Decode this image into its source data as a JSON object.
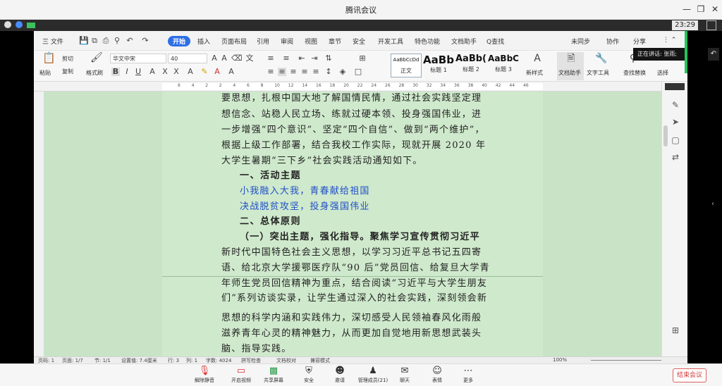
{
  "window": {
    "title": "腾讯会议",
    "time": "23:29"
  },
  "menu": {
    "file": "三 文件",
    "items": [
      "开始",
      "插入",
      "页面布局",
      "引用",
      "审阅",
      "视图",
      "章节",
      "安全",
      "开发工具",
      "特色功能",
      "文档助手",
      "Q查找"
    ],
    "right": [
      "未同步",
      "协作",
      "分享"
    ]
  },
  "ribbon": {
    "paste": "粘贴",
    "cut": "剪切",
    "copy": "复制",
    "format_painter": "格式刷",
    "font_name": "华文中宋",
    "font_size": "40",
    "styles": [
      {
        "sample": "AaBbCcDd",
        "label": "正文"
      },
      {
        "sample": "AaBb",
        "label": "标题 1"
      },
      {
        "sample": "AaBb(",
        "label": "标题 2"
      },
      {
        "sample": "AaBbC",
        "label": "标题 3"
      }
    ],
    "new_style": "新样式",
    "doc_assistant": "文档助手",
    "text_tools": "文字工具",
    "find_replace": "查找替换",
    "select": "选择"
  },
  "ruler_numbers": [
    "6",
    "4",
    "2",
    "2",
    "4",
    "6",
    "8",
    "10",
    "12",
    "14",
    "16",
    "18",
    "20",
    "22",
    "24",
    "26",
    "28",
    "30",
    "32",
    "34",
    "36",
    "38",
    "40",
    "42",
    "44",
    "46"
  ],
  "presenter": "正在讲话: 张雨;",
  "document": {
    "lines": [
      "要思想，扎根中国大地了解国情民情，通过社会实践坚定理",
      "想信念、站稳人民立场、练就过硬本领、投身强国伟业，进",
      "一步增强“四个意识”、坚定“四个自信”、做到“两个维护”，",
      "根据上级工作部署，结合我校工作实际，现就开展 2020 年",
      "大学生暑期“三下乡”社会实践活动通知如下。",
      "一、活动主题",
      "小我融入大我，青春献给祖国",
      "决战脱贫攻坚，投身强国伟业",
      "二、总体原则",
      "（一）突出主题，强化指导。聚焦学习宣传贯彻习近平",
      "新时代中国特色社会主义思想，以学习习近平总书记五四寄",
      "语、给北京大学援鄂医疗队“90 后”党员回信、给复旦大学青",
      "年师生党员回信精神为重点，结合阅读“习近平与大学生朋友",
      "们”系列访谈实录，让学生通过深入的社会实践，深刻领会新",
      "思想的科学内涵和实践伟力，深切感受人民领袖春风化雨般",
      "滋养青年心灵的精神魅力，从而更加自觉地用新思想武装头",
      "脑、指导实践。"
    ]
  },
  "wps_status": {
    "page": "页码: 1",
    "pages": "页面: 1/7",
    "section": "节: 1/1",
    "setting": "设置值: 7.4厘米",
    "row": "行: 3",
    "col": "列: 1",
    "words": "字数: 4024",
    "spell": "拼写检查",
    "proof": "文档校对",
    "compat": "兼容模式",
    "zoom": "100%"
  },
  "meeting_bar": {
    "buttons": [
      "解除静音",
      "开启视频",
      "共享屏幕",
      "安全",
      "邀请",
      "管理成员(21)",
      "聊天",
      "表情",
      "更多"
    ],
    "end": "结束会议"
  }
}
